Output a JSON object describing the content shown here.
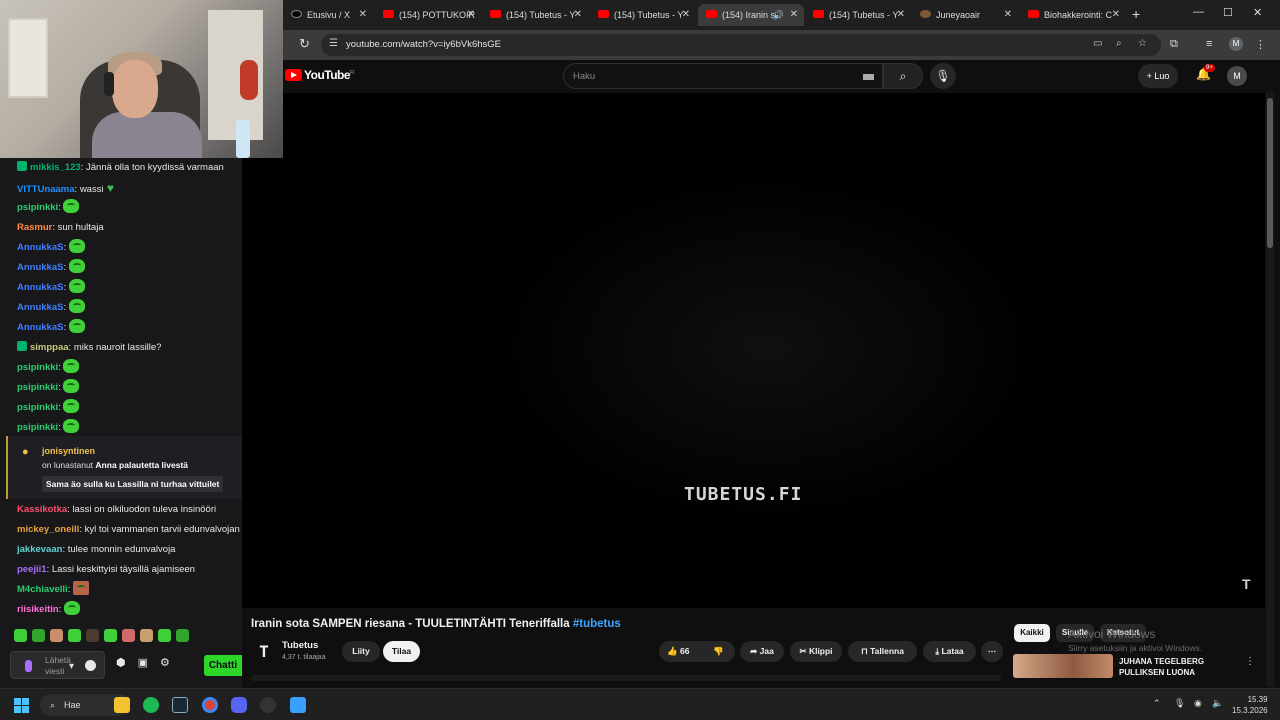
{
  "chat": {
    "messages": [
      {
        "user": "mikkis_123",
        "text": ": Jännä olla ton kyydissä varmaan",
        "color": "#00b36b",
        "badge": true
      },
      {
        "user": "VITTUnaama",
        "text": ": wassi",
        "color": "#1e90ff",
        "heart": true
      },
      {
        "user": "psipinkki",
        "text": ":",
        "color": "#2ecc71",
        "emote": true
      },
      {
        "user": "Rasmur",
        "text": ": sun hultaja",
        "color": "#ff8c42"
      },
      {
        "user": "AnnukkaS",
        "text": ":",
        "color": "#3f7fff",
        "emote": true
      },
      {
        "user": "AnnukkaS",
        "text": ":",
        "color": "#3f7fff",
        "emote": true
      },
      {
        "user": "AnnukkaS",
        "text": ":",
        "color": "#3f7fff",
        "emote": true
      },
      {
        "user": "AnnukkaS",
        "text": ":",
        "color": "#3f7fff",
        "emote": true
      },
      {
        "user": "AnnukkaS",
        "text": ":",
        "color": "#3f7fff",
        "emote": true
      },
      {
        "user": "simppaa",
        "text": ": miks nauroit lassille?",
        "color": "#c9c97a",
        "badge": true
      },
      {
        "user": "psipinkki",
        "text": ":",
        "color": "#2ecc71",
        "emote": true
      },
      {
        "user": "psipinkki",
        "text": ":",
        "color": "#2ecc71",
        "emote": true
      },
      {
        "user": "psipinkki",
        "text": ":",
        "color": "#2ecc71",
        "emote": true
      },
      {
        "user": "psipinkki",
        "text": ":",
        "color": "#2ecc71",
        "emote": true
      }
    ],
    "redeem": {
      "user": "jonisyntinen",
      "prefix": "on lunastanut",
      "reward": "Anna palautetta livestä",
      "message": "Sama äo sulla ku Lassilla ni turhaa vittuilet"
    },
    "messages2": [
      {
        "user": "Kassikotka",
        "text": ": lassi on olkiluodon tuleva insinööri",
        "color": "#ff4d6d"
      },
      {
        "user": "mickey_oneill",
        "text": ": kyl toi vammanen tarvii edunvalvojan",
        "color": "#e6a23c"
      },
      {
        "user": "jakkevaan",
        "text": ": tulee monnin edunvalvoja",
        "color": "#5fd3d3"
      },
      {
        "user": "peejii1",
        "text": ": Lassi keskittyisi täysillä ajamiseen",
        "color": "#a970ff"
      },
      {
        "user": "M4chiavelli",
        "text": ":",
        "color": "#2ecc71",
        "img": true
      },
      {
        "user": "riisikeitin",
        "text": ":",
        "color": "#ff6fd8",
        "emote": true
      }
    ],
    "input_placeholder": "Lähetä viesti",
    "chat_button": "Chatti"
  },
  "browser": {
    "tabs": [
      {
        "label": "Etusivu / X",
        "icon": "x-icon"
      },
      {
        "label": "(154) POTTUKOIR",
        "icon": "youtube-icon"
      },
      {
        "label": "(154) Tubetus - Y",
        "icon": "youtube-icon"
      },
      {
        "label": "(154) Tubetus - Y",
        "icon": "youtube-icon"
      },
      {
        "label": "(154) Iranin s",
        "icon": "youtube-icon"
      },
      {
        "label": "(154) Tubetus - Y",
        "icon": "youtube-icon"
      },
      {
        "label": "Juneyaoair",
        "icon": "globe-icon"
      },
      {
        "label": "Biohakkerointi: C",
        "icon": "youtube-icon"
      }
    ],
    "url": "youtube.com/watch?v=iy6bVk6hsGE"
  },
  "youtube": {
    "logo_text": "YouTube",
    "region": "FI",
    "search_placeholder": "Haku",
    "create_label": "Luo",
    "notif_count": "9+",
    "avatar_letter": "M",
    "watermark": "TUBETUS.FI",
    "video_title": "Iranin sota SAMPEN riesana - TUULETINTÄHTI Teneriffalla",
    "video_hashtag": "#tubetus",
    "channel_name": "Tubetus",
    "channel_subs": "4,37 t. tilaajaa",
    "join_label": "Liity",
    "subscribe_label": "Tilaa",
    "like_count": "66",
    "share_label": "Jaa",
    "clip_label": "Klippi",
    "save_label": "Tallenna",
    "download_label": "Lataa",
    "chips": [
      "Kaikki",
      "Sinulle",
      "Katsotut"
    ],
    "rec_title_1": "JUHANA TEGELBERG",
    "rec_title_2": "PULLIKSEN LUONA",
    "activate_title": "Aktivoi Windows",
    "activate_text": "Siirry asetuksiin ja aktivoi Windows."
  },
  "taskbar": {
    "search_label": "Hae",
    "time": "15.39",
    "date": "15.3.2026"
  }
}
